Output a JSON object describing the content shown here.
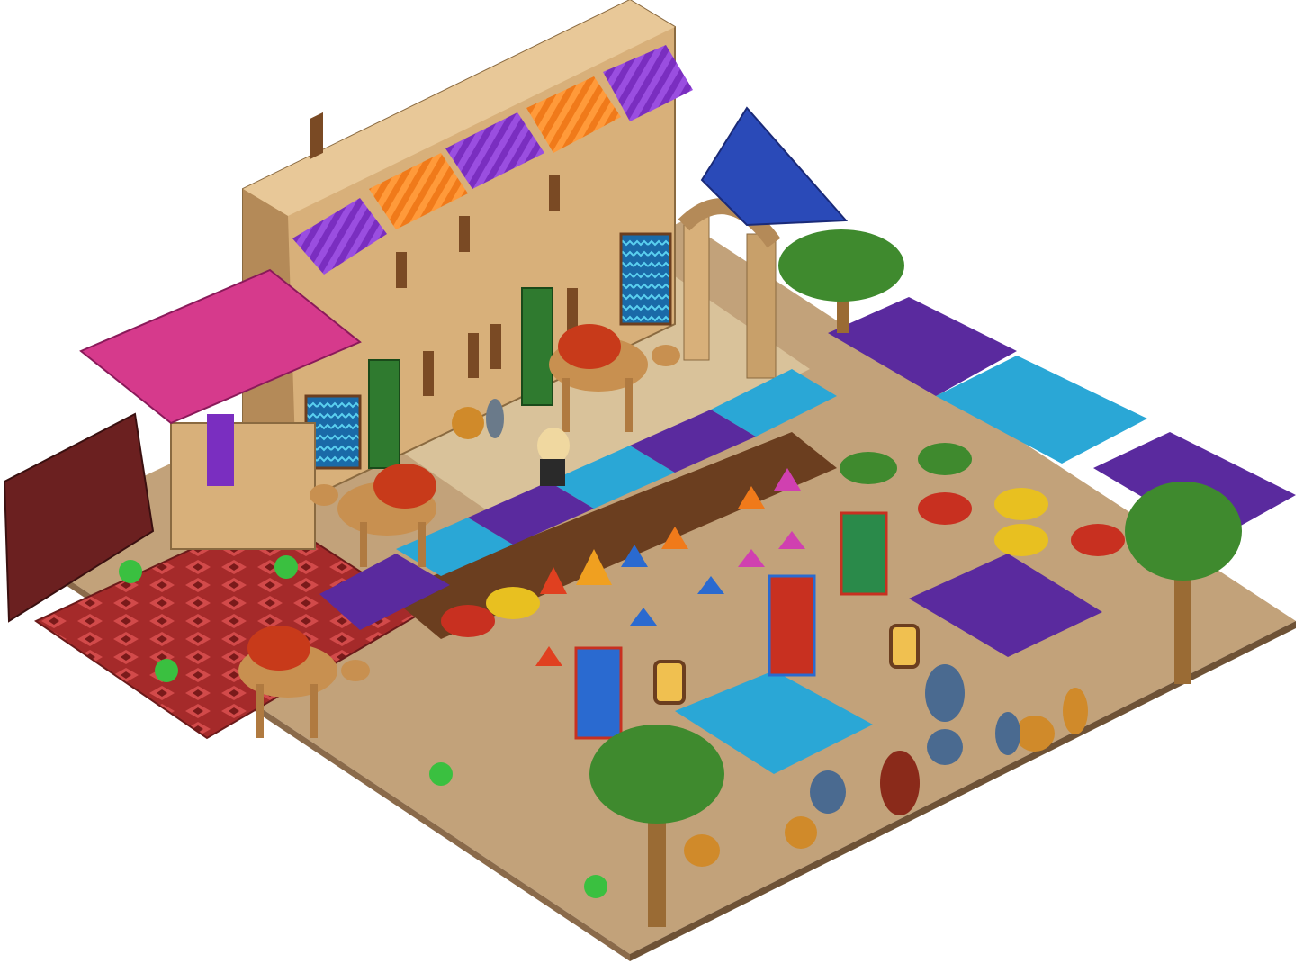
{
  "scene": {
    "type": "isometric-room",
    "theme": "desert bazaar market",
    "colors": {
      "floor": "#c2a27a",
      "floor_edge_left": "#8a6a4a",
      "floor_edge_right": "#6e5236",
      "plaza": "#d9c29a",
      "wall_face": "#d8b07a",
      "wall_top": "#e8c898",
      "wall_side": "#b48a58",
      "carpet": "#a52a2a",
      "carpet_pattern": "#d24a4a",
      "awning_pink": "#d63a8c",
      "awning_purple": "#7a2ec0",
      "awning_orange": "#f07a1a",
      "canopy_purple": "#5a2a9e",
      "canopy_blue": "#2aa7d6",
      "wood": "#6b3e1f",
      "palm_green": "#3f8a2e",
      "palm_trunk": "#9a6b34",
      "door_green": "#2f7a2f",
      "flag_blue": "#2a4ab8"
    },
    "icons": [
      "camel-icon",
      "palm-tree-icon",
      "hookah-icon",
      "lantern-icon",
      "spice-pile-icon",
      "fruit-basket-icon",
      "pottery-vase-icon",
      "rug-roll-icon",
      "flag-banner-icon",
      "avatar-icon"
    ]
  }
}
